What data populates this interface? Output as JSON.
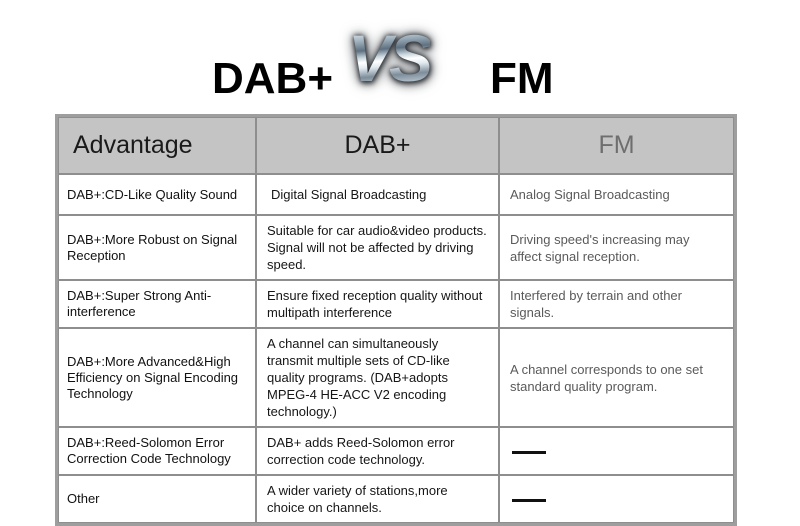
{
  "title": {
    "left": "DAB+",
    "vs": "VS",
    "right": "FM"
  },
  "table": {
    "headers": {
      "advantage": "Advantage",
      "dab": "DAB+",
      "fm": "FM"
    },
    "rows": [
      {
        "advantage": "DAB+:CD-Like Quality Sound",
        "dab": "Digital Signal Broadcasting",
        "fm": "Analog Signal Broadcasting"
      },
      {
        "advantage": "DAB+:More Robust on Signal Reception",
        "dab": "Suitable for car audio&video products. Signal will not be affected by driving speed.",
        "fm": "Driving speed's increasing may affect signal reception."
      },
      {
        "advantage": "DAB+:Super Strong Anti-interference",
        "dab": "Ensure fixed reception quality without multipath interference",
        "fm": "Interfered by terrain and other signals."
      },
      {
        "advantage": "DAB+:More Advanced&High Efficiency on Signal Encoding Technology",
        "dab": "A channel can simultaneously transmit multiple sets of CD-like quality programs. (DAB+adopts MPEG-4 HE-ACC V2 encoding technology.)",
        "fm": "A channel corresponds to one set standard quality program."
      },
      {
        "advantage": "DAB+:Reed-Solomon Error Correction Code Technology",
        "dab": "DAB+ adds Reed-Solomon error correction code technology.",
        "fm": ""
      },
      {
        "advantage": "Other",
        "dab": "A wider variety of stations,more choice on channels.",
        "fm": ""
      }
    ]
  },
  "colors": {
    "header_background": "#c4c4c4",
    "table_frame": "#9e9e9e",
    "cell_border": "#8e8e8e",
    "fm_text": "#5a5a5a",
    "fm_header_text": "#6e6e6e",
    "primary_text": "#111111",
    "page_background": "#ffffff"
  }
}
